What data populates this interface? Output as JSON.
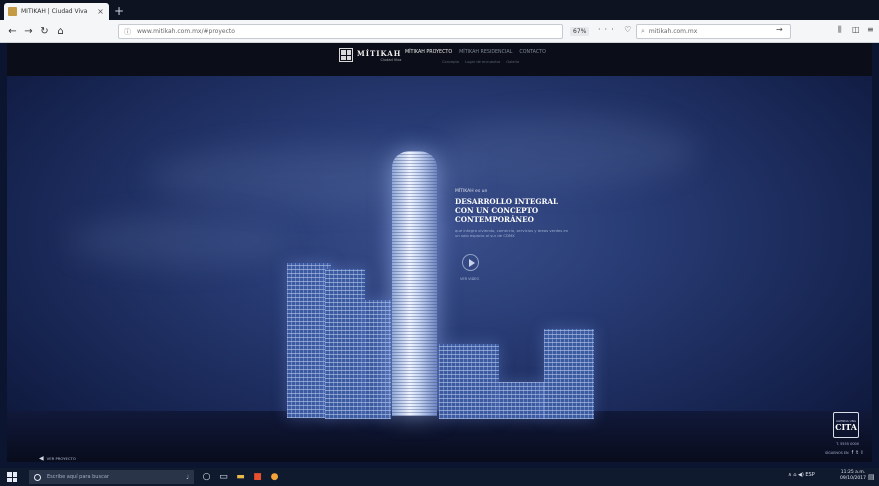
{
  "browser": {
    "tab_title": "MÍTIKAH | Ciudad Viva",
    "tab_close": "×",
    "new_tab": "+",
    "url": "www.mitikah.com.mx/#proyecto",
    "zoom": "67%",
    "page_actions": "··· ♡ ☆",
    "search_text": "mitikah.com.mx",
    "search_go": "→"
  },
  "site": {
    "logo_name": "MÍTIKAH",
    "logo_sub": "Ciudad Viva",
    "nav": [
      "Mítikah proyecto",
      "Mítikah residencial",
      "Contacto"
    ],
    "subnav": [
      "Concepto",
      "Lugar de encuentro",
      "Galería"
    ]
  },
  "hero": {
    "intro": "MÍTIKAH es un",
    "headline": [
      "DESARROLLO INTEGRAL",
      "CON UN CONCEPTO",
      "CONTEMPORÁNEO"
    ],
    "body": "que integra vivienda, comercio, servicios y áreas verdes en un solo espacio al sur de CDMX",
    "play_label": "VER VIDEO",
    "bottom_left_label": "VER PROYECTO",
    "cita_top": "AGENDA UNA",
    "cita_text": "CITA",
    "cita_contact": "T. 5555 0000",
    "social_label": "SÍGUENOS EN",
    "social_icons": [
      "f",
      "t",
      "i"
    ]
  },
  "taskbar": {
    "search_placeholder": "Escribe aquí para buscar",
    "tray": "∧ ⌂ ◀) ESP",
    "time": "11:25 a.m.",
    "date": "09/10/2017"
  },
  "colors": {
    "sky_top": "#3a4f8c",
    "sky_bottom": "#0c1434",
    "chrome_bg": "#f5f6f7",
    "taskbar_bg": "#101a2e"
  }
}
